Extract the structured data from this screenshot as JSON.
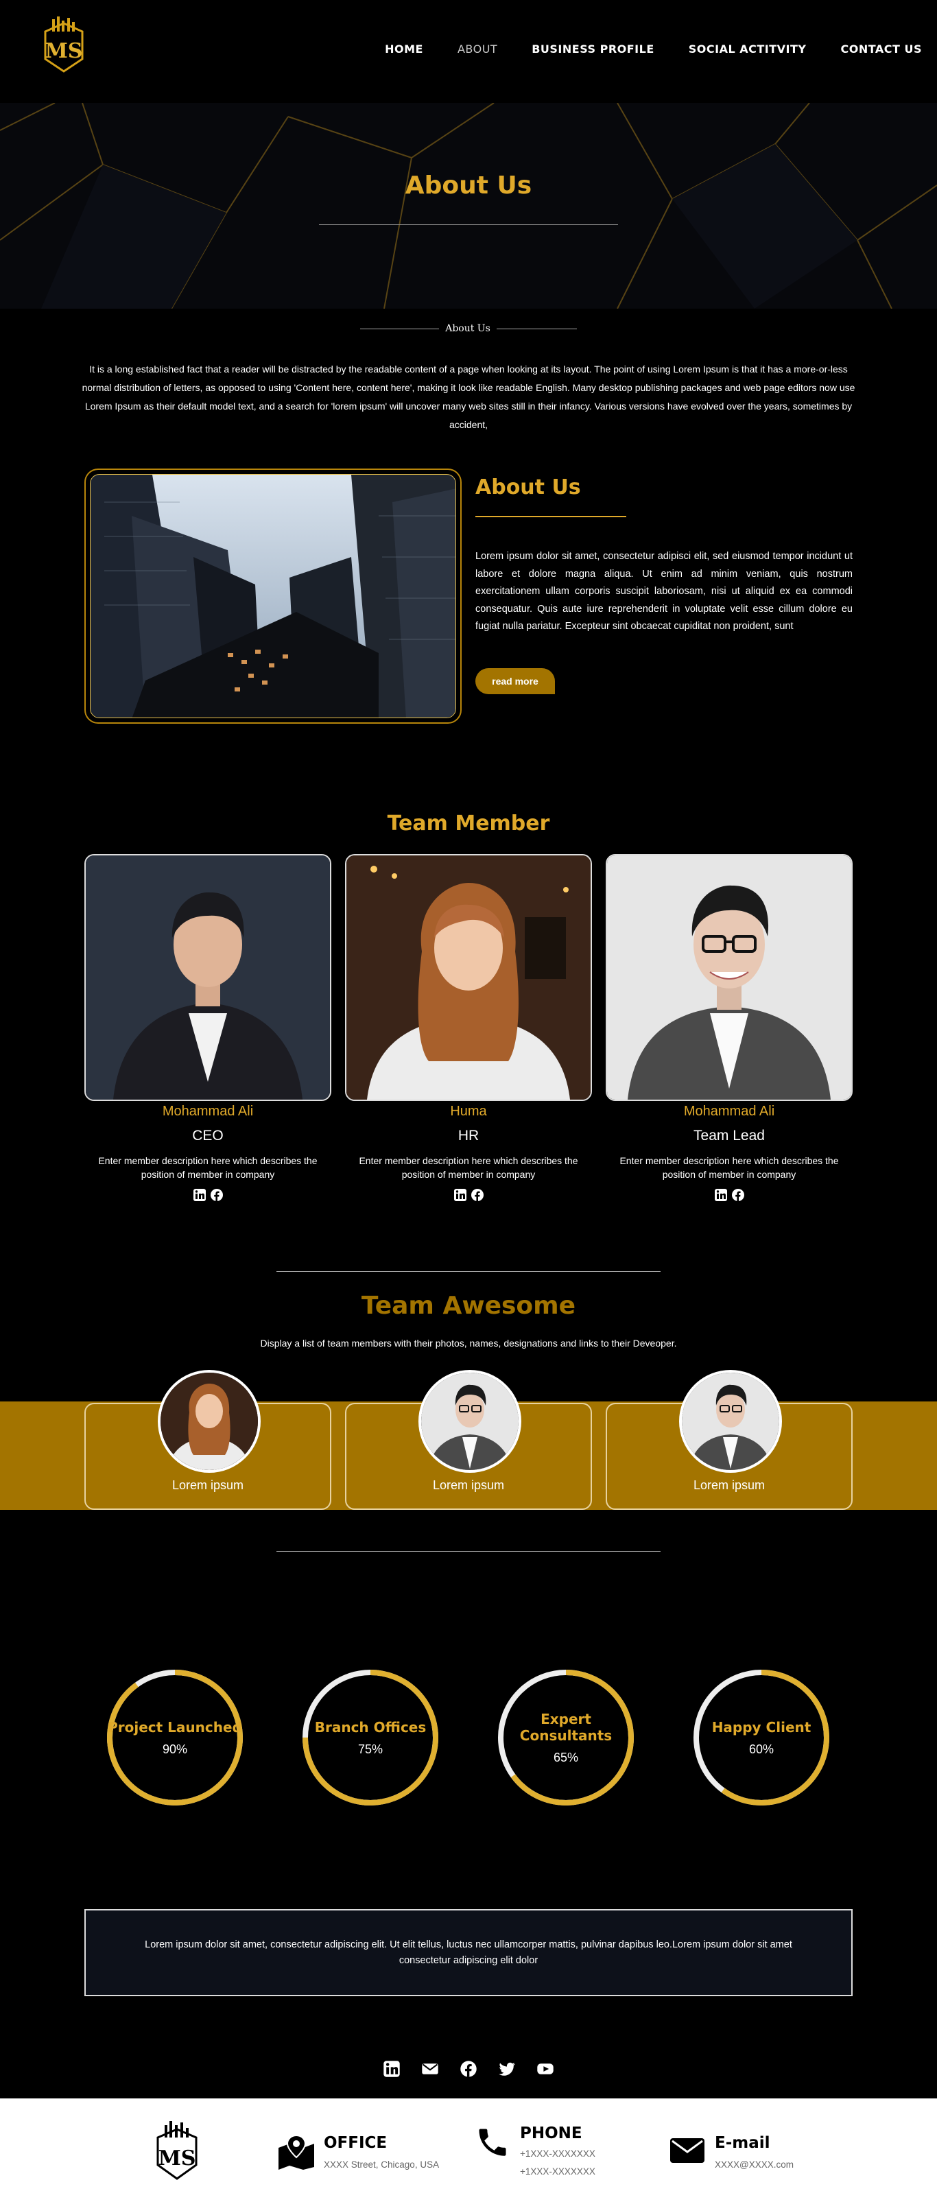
{
  "nav": {
    "logo_text": "MS",
    "items": [
      {
        "label": "HOME",
        "active": false
      },
      {
        "label": "ABOUT",
        "active": true
      },
      {
        "label": "BUSINESS PROFILE",
        "active": false
      },
      {
        "label": "SOCIAL ACTITVITY",
        "active": false
      },
      {
        "label": "CONTACT US",
        "active": false
      }
    ]
  },
  "hero": {
    "title": "About Us"
  },
  "intro": {
    "heading": "About Us",
    "text": "It is a long established fact that a reader will be distracted by the readable content of a page when looking at its layout. The point of using Lorem Ipsum is that it has a more-or-less normal distribution of letters, as opposed to using 'Content here, content here', making it look like readable English. Many desktop publishing packages and web page editors now use Lorem Ipsum as their default model text, and a search for 'lorem ipsum' will uncover many web sites still in their infancy. Various versions have evolved over the years, sometimes by accident,"
  },
  "about": {
    "title": "About Us",
    "text": "Lorem ipsum dolor sit amet, consectetur adipisci elit, sed eiusmod tempor incidunt ut labore et dolore magna aliqua. Ut enim ad minim veniam, quis nostrum exercitationem ullam corporis suscipit laboriosam, nisi ut aliquid ex ea commodi consequatur. Quis aute iure reprehenderit in voluptate velit esse cillum dolore eu fugiat nulla pariatur. Excepteur sint obcaecat cupiditat non proident, sunt",
    "button": "read more"
  },
  "team": {
    "title": "Team Member",
    "members": [
      {
        "name": "Mohammad Ali",
        "role": "CEO",
        "desc": "Enter member description here which describes the position of member in company"
      },
      {
        "name": "Huma",
        "role": "HR",
        "desc": "Enter member description here which describes the position of member in company"
      },
      {
        "name": "Mohammad Ali",
        "role": "Team Lead",
        "desc": "Enter member description here which describes the position of member in company"
      }
    ]
  },
  "awesome": {
    "title": "Team Awesome",
    "subtitle": "Display a list of team members with their photos, names, designations and links to their Deveoper.",
    "cards": [
      {
        "label": "Lorem ipsum"
      },
      {
        "label": "Lorem ipsum"
      },
      {
        "label": "Lorem ipsum"
      }
    ]
  },
  "counters": [
    {
      "title": "Project Launched",
      "value": "90%",
      "progress": 0.9
    },
    {
      "title": "Branch Offices",
      "value": "75%",
      "progress": 0.75
    },
    {
      "title": "Expert Consultants",
      "value": "65%",
      "progress": 0.65
    },
    {
      "title": "Happy Client",
      "value": "60%",
      "progress": 0.6
    }
  ],
  "quote": {
    "text": "Lorem ipsum dolor sit amet, consectetur adipiscing elit. Ut elit tellus, luctus nec ullamcorper mattis, pulvinar dapibus leo.Lorem ipsum dolor sit amet consectetur adipiscing elit dolor"
  },
  "footer": {
    "office": {
      "title": "OFFICE",
      "line": "XXXX Street, Chicago, USA"
    },
    "phone": {
      "title": "PHONE",
      "line1": "+1XXX-XXXXXXX",
      "line2": "+1XXX-XXXXXXX"
    },
    "email": {
      "title": "E-mail",
      "line": "XXXX@XXXX.com"
    }
  },
  "colors": {
    "gold": "#e0a92a",
    "band": "#a37400",
    "background": "#000000"
  }
}
